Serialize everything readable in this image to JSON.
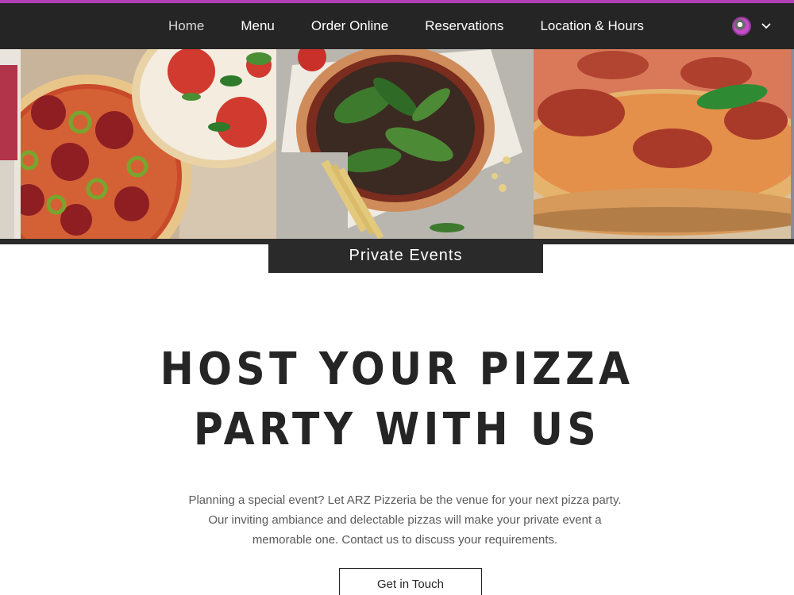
{
  "nav": {
    "items": [
      {
        "label": "Home",
        "active": true
      },
      {
        "label": "Menu"
      },
      {
        "label": "Order Online"
      },
      {
        "label": "Reservations"
      },
      {
        "label": "Location & Hours"
      }
    ]
  },
  "colors": {
    "accent": "#b23fb8",
    "navbar_bg": "#252525",
    "tab_bg": "#2a2a2a",
    "heading": "#252525",
    "body_text": "#5a5a5a"
  },
  "icons": {
    "account": "user-avatar-icon",
    "dropdown": "chevron-down-icon"
  },
  "hero_gallery": [
    "pepperoni-jalapeno-pizza-photo",
    "arugula-pizza-photo",
    "pepperoni-pizza-closeup-photo"
  ],
  "section": {
    "tab_label": "Private Events",
    "headline": "HOST YOUR PIZZA PARTY WITH US",
    "body": "Planning a special event? Let ARZ Pizzeria be the venue for your next pizza party. Our inviting ambiance and delectable pizzas will make your private event a memorable one. Contact us to discuss your requirements.",
    "cta_label": "Get in Touch"
  }
}
